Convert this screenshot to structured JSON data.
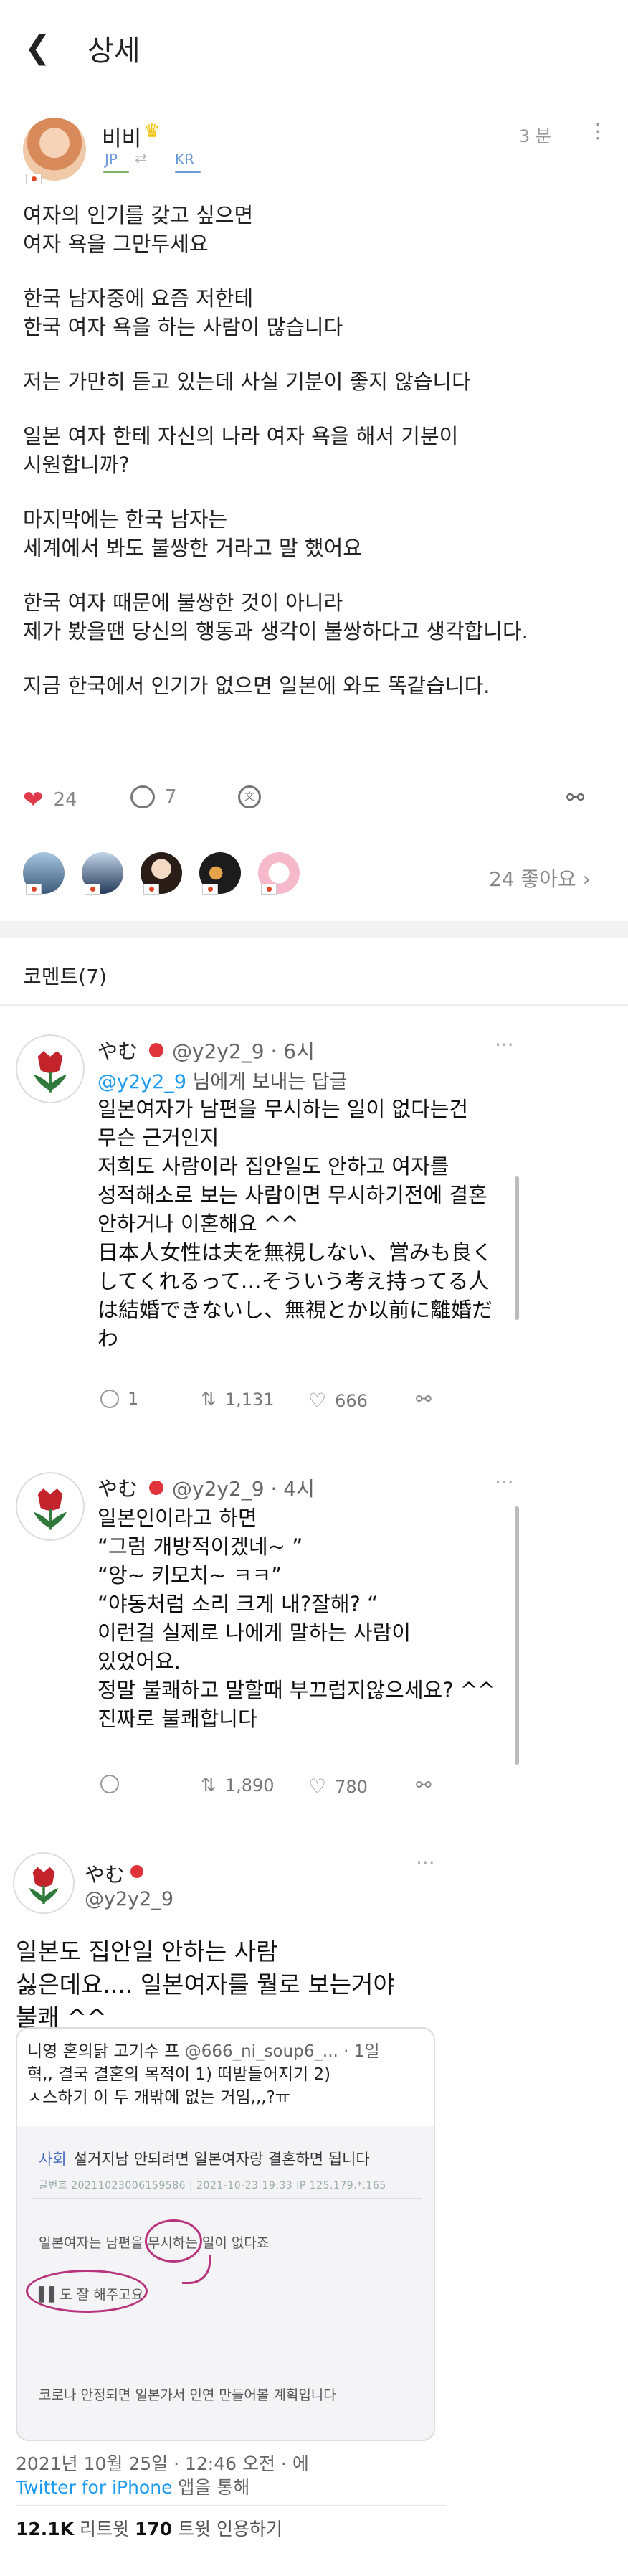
{
  "header": {
    "back_icon": "back-chevron-icon",
    "title": "상세"
  },
  "post": {
    "username": "비비",
    "badge_icon": "crown-icon",
    "lang_from": "JP",
    "lang_to": "KR",
    "time": "3 분",
    "paragraphs": [
      [
        "여자의 인기를 갖고 싶으면",
        "여자 욕을 그만두세요"
      ],
      [
        "한국 남자중에 요즘 저한테",
        "한국 여자 욕을 하는 사람이 많습니다"
      ],
      [
        "저는 가만히 듣고 있는데 사실 기분이 좋지 않습니다"
      ],
      [
        "일본 여자 한테 자신의 나라 여자 욕을 해서 기분이",
        "시원합니까?"
      ],
      [
        "마지막에는 한국 남자는",
        "세계에서 봐도 불쌍한 거라고 말 했어요"
      ],
      [
        "한국 여자 때문에 불쌍한 것이 아니라",
        "제가 봤을땐 당신의 행동과 생각이 불쌍하다고 생각합니다."
      ],
      [
        "지금 한국에서 인기가 없으면 일본에 와도 똑같습니다."
      ]
    ],
    "likes": "24",
    "comments": "7",
    "likes_label": "24 좋아요",
    "accent_like": "#e03b4b"
  },
  "comments_header": "코멘트(7)",
  "tweet1": {
    "name": "やむ",
    "handle": "@y2y2_9 · 6시",
    "reply_to": "@y2y2_9",
    "reply_suffix": " 님에게 보내는 답글",
    "lines": [
      "일본여자가 남편을 무시하는 일이 없다는건",
      "무슨 근거인지",
      "저희도 사람이라 집안일도 안하고 여자를",
      "성적해소로 보는 사람이면 무시하기전에 결혼",
      "안하거나 이혼해요 ^^",
      "日本人女性は夫を無視しない、営みも良く",
      "してくれるって…そういう考え持ってる人",
      "は結婚できないし、無視とか以前に離婚だ",
      "わ"
    ],
    "replies": "1",
    "retweets": "1,131",
    "likes": "666"
  },
  "tweet2": {
    "name": "やむ",
    "handle": "@y2y2_9 · 4시",
    "lines": [
      "일본인이라고 하면",
      "“그럼 개방적이겠네~ ”",
      "“앙~ 키모치~ ㅋㅋ”",
      "“야동처럼 소리 크게 내?잘해? “",
      "이런걸 실제로 나에게 말하는 사람이",
      "있었어요.",
      "정말 불쾌하고 말할때 부끄럽지않으세요? ^^",
      "진짜로 불쾌합니다"
    ],
    "retweets": "1,890",
    "likes": "780"
  },
  "tweet3": {
    "name": "やむ",
    "handle": "@y2y2_9",
    "lines": [
      "일본도 집안일 안하는 사람",
      "싫은데요.... 일본여자를 뭘로 보는거야",
      "불쾌 ^^"
    ],
    "quote_name": "니영 혼의닭 고기수 프",
    "quote_handle": "@666_ni_soup6_...",
    "quote_time": "· 1일",
    "quote_lines": [
      "혁,, 결국 결혼의 목적이 1) 떠받들어지기 2)",
      "ㅅ스하기 이 두 개밖에 없는 거임,,,?ㅠ"
    ],
    "shot_category": "사회",
    "shot_title": "설거지남 안되려면 일본여자랑 결혼하면 됩니다",
    "shot_meta": "글번호 20211023006159586 | 2021-10-23 19:33   IP 125.179.*.165",
    "shot_line1": "일본여자는 남편을 무시하는 일이 없다죠",
    "shot_line2": "▌▌도 잘 해주고요",
    "shot_line3": "코로나 안정되면 일본가서 인연 만들어볼 계획입니다",
    "date": "2021년 10월 25일 · 12:46 오전 · 에",
    "via": "Twitter for iPhone",
    "via_suffix": " 앱을 통해",
    "retweets_num": "12.1K",
    "retweets_label": " 리트윗  ",
    "quotes_num": "170",
    "quotes_label": " 트윗 인용하기"
  }
}
